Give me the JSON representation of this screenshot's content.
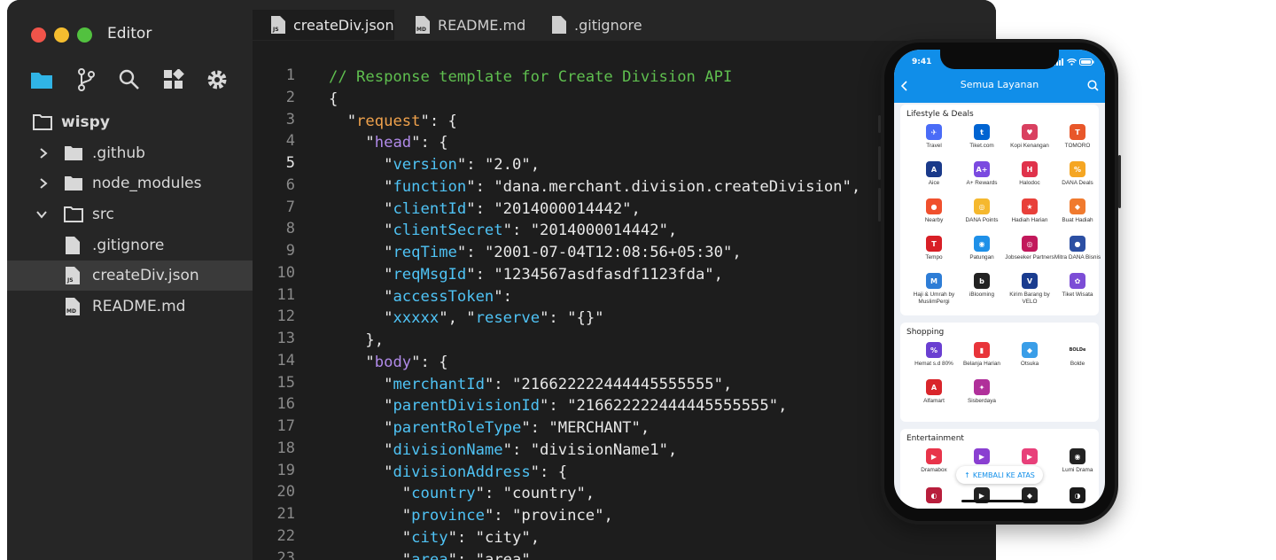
{
  "editor": {
    "title": "Editor",
    "activity_icons": [
      "folder-icon",
      "branch-icon",
      "search-icon",
      "extensions-icon",
      "gear-icon"
    ],
    "tree": [
      {
        "label": "wispy",
        "type": "folder-open",
        "depth": 0
      },
      {
        "label": ".github",
        "type": "folder",
        "depth": 1,
        "expanded": false
      },
      {
        "label": "node_modules",
        "type": "folder",
        "depth": 1,
        "expanded": false
      },
      {
        "label": "src",
        "type": "folder",
        "depth": 1,
        "expanded": true
      },
      {
        "label": ".gitignore",
        "type": "file",
        "depth": 2
      },
      {
        "label": "createDiv.json",
        "type": "file-json",
        "depth": 2,
        "active": true
      },
      {
        "label": "README.md",
        "type": "file-md",
        "depth": 2
      }
    ],
    "tabs": [
      {
        "label": "createDiv.json",
        "badge": "JS",
        "active": true
      },
      {
        "label": "README.md",
        "badge": "MD",
        "active": false
      },
      {
        "label": ".gitignore",
        "badge": "",
        "active": false
      }
    ],
    "current_line": 5,
    "code_lines": [
      "// Response template for Create Division API",
      "{",
      "  \"request\": {",
      "    \"head\": {",
      "      \"version\": \"2.0\",",
      "      \"function\": \"dana.merchant.division.createDivision\",",
      "      \"clientId\": \"2014000014442\",",
      "      \"clientSecret\": \"2014000014442\",",
      "      \"reqTime\": \"2001-07-04T12:08:56+05:30\",",
      "      \"reqMsgId\": \"1234567asdfasdf1123fda\",",
      "      \"accessToken\":",
      "      \"xxxxx\", \"reserve\": \"{}\"",
      "    },",
      "    \"body\": {",
      "      \"merchantId\": \"216622222444445555555\",",
      "      \"parentDivisionId\": \"216622222444445555555\",",
      "      \"parentRoleType\": \"MERCHANT\",",
      "      \"divisionName\": \"divisionName1\",",
      "      \"divisionAddress\": {",
      "        \"country\": \"country\",",
      "        \"province\": \"province\",",
      "        \"city\": \"city\",",
      "        \"area\": \"area\","
    ],
    "colors": {
      "comment": "#5fbf4f",
      "key": "#4fc3f5",
      "request": "#f0a24c",
      "nested": "#b08ae8",
      "text": "#e8e8e8"
    }
  },
  "phone": {
    "time": "9:41",
    "header_title": "Semua Layanan",
    "accent": "#108ee9",
    "back_to_top": "KEMBALI KE ATAS",
    "sections": [
      {
        "title": "Lifestyle & Deals",
        "items": [
          {
            "label": "Travel",
            "color": "#4a6cf7",
            "glyph": "✈"
          },
          {
            "label": "Tiket.com",
            "color": "#0064d2",
            "glyph": "t"
          },
          {
            "label": "Kopi Kenangan",
            "color": "#d94060",
            "glyph": "♥"
          },
          {
            "label": "TOMORO",
            "color": "#e8572a",
            "glyph": "T"
          },
          {
            "label": "Aice",
            "color": "#1a3a8a",
            "glyph": "A"
          },
          {
            "label": "A+ Rewards",
            "color": "#7b4ae0",
            "glyph": "A+"
          },
          {
            "label": "Halodoc",
            "color": "#e0324b",
            "glyph": "H"
          },
          {
            "label": "DANA Deals",
            "color": "#f5a623",
            "glyph": "%"
          },
          {
            "label": "Nearby",
            "color": "#f0502d",
            "glyph": "●"
          },
          {
            "label": "DANA Points",
            "color": "#f5b82e",
            "glyph": "◎"
          },
          {
            "label": "Hadiah Harian",
            "color": "#e8403a",
            "glyph": "★"
          },
          {
            "label": "Buat Hadiah",
            "color": "#f07a2e",
            "glyph": "◆"
          },
          {
            "label": "Tempo",
            "color": "#d81f26",
            "glyph": "T"
          },
          {
            "label": "Patungan",
            "color": "#1e90e8",
            "glyph": "◉"
          },
          {
            "label": "Jobseeker Partners",
            "color": "#c2185b",
            "glyph": "◎"
          },
          {
            "label": "Mitra DANA Bisnis",
            "color": "#2c4fa3",
            "glyph": "●"
          },
          {
            "label": "Haji & Umrah by MuslimPergi",
            "color": "#2e7dd6",
            "glyph": "M"
          },
          {
            "label": "iBlooming",
            "color": "#222222",
            "glyph": "b"
          },
          {
            "label": "Kirim Barang by VELO",
            "color": "#1a3c8f",
            "glyph": "V"
          },
          {
            "label": "Tiket Wisata",
            "color": "#7c4dd6",
            "glyph": "✿"
          }
        ]
      },
      {
        "title": "Shopping",
        "items": [
          {
            "label": "Hemat s.d 80%",
            "color": "#6a3fd1",
            "glyph": "%"
          },
          {
            "label": "Belanja Harian",
            "color": "#e8343a",
            "glyph": "▮"
          },
          {
            "label": "Otsuka",
            "color": "#3a9ee8",
            "glyph": "◆"
          },
          {
            "label": "Bolde",
            "color": "#ffffff",
            "glyph": "BOLDe"
          },
          {
            "label": "Alfamart",
            "color": "#d9252b",
            "glyph": "A"
          },
          {
            "label": "Sisberdaya",
            "color": "#b0309a",
            "glyph": "✦"
          }
        ]
      },
      {
        "title": "Entertainment",
        "items": [
          {
            "label": "Dramabox",
            "color": "#e8344a",
            "glyph": "▶"
          },
          {
            "label": "",
            "color": "#8a3fd1",
            "glyph": "▶"
          },
          {
            "label": "",
            "color": "#e8407a",
            "glyph": "▶"
          },
          {
            "label": "Lumi Drama",
            "color": "#222222",
            "glyph": "◉"
          }
        ]
      }
    ],
    "bottom_row": [
      {
        "color": "#b81e3c",
        "glyph": "◐"
      },
      {
        "color": "#222222",
        "glyph": "▶"
      },
      {
        "color": "#222222",
        "glyph": "◆"
      },
      {
        "color": "#1b1b1b",
        "glyph": "◑"
      }
    ]
  }
}
